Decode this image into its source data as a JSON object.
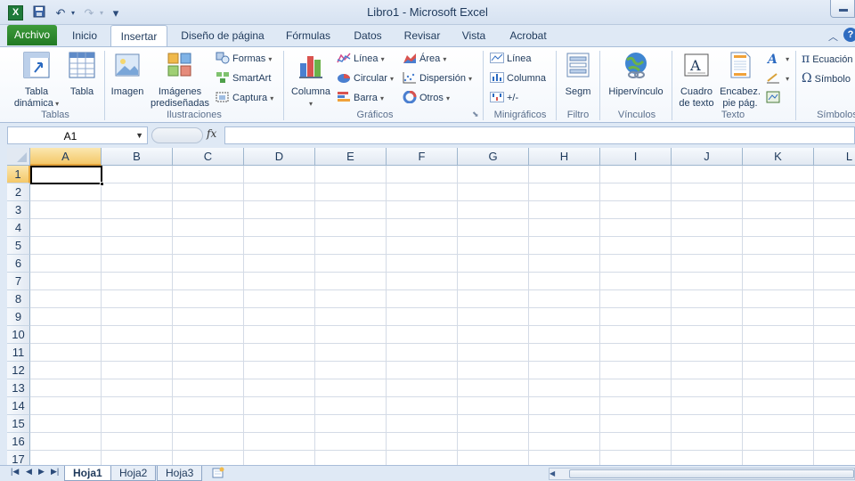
{
  "window": {
    "title": "Libro1  -  Microsoft Excel",
    "app_icon": "X"
  },
  "qat": {
    "save": "save-icon",
    "undo": "↶",
    "redo": "↷",
    "customize": "▾"
  },
  "tabs": {
    "file": "Archivo",
    "items": [
      "Inicio",
      "Insertar",
      "Diseño de página",
      "Fórmulas",
      "Datos",
      "Revisar",
      "Vista",
      "Acrobat"
    ],
    "active": "Insertar"
  },
  "ribbon": {
    "tablas": {
      "label": "Tablas",
      "pivot": "Tabla\ndinámica",
      "table": "Tabla"
    },
    "ilustraciones": {
      "label": "Ilustraciones",
      "image": "Imagen",
      "clipart": "Imágenes\nprediseñadas",
      "shapes": "Formas",
      "smartart": "SmartArt",
      "screenshot": "Captura"
    },
    "graficos": {
      "label": "Gráficos",
      "column": "Columna",
      "line": "Línea",
      "pie": "Circular",
      "bar": "Barra",
      "area": "Área",
      "scatter": "Dispersión",
      "other": "Otros"
    },
    "minigraficos": {
      "label": "Minigráficos",
      "line": "Línea",
      "column": "Columna",
      "winloss": "+/-"
    },
    "filtro": {
      "label": "Filtro",
      "slicer": "Segm"
    },
    "vinculos": {
      "label": "Vínculos",
      "hyperlink": "Hipervínculo"
    },
    "texto": {
      "label": "Texto",
      "textbox": "Cuadro\nde texto",
      "header": "Encabez.\npie pág."
    },
    "simbolos": {
      "label": "Símbolos",
      "equation": "Ecuación",
      "symbol": "Símbolo"
    }
  },
  "formula_bar": {
    "namebox": "A1",
    "fx": "fx",
    "value": ""
  },
  "grid": {
    "columns": [
      "A",
      "B",
      "C",
      "D",
      "E",
      "F",
      "G",
      "H",
      "I",
      "J",
      "K",
      "L"
    ],
    "rows": [
      "1",
      "2",
      "3",
      "4",
      "5",
      "6",
      "7",
      "8",
      "9",
      "10",
      "11",
      "12",
      "13",
      "14",
      "15",
      "16",
      "17"
    ],
    "active_cell": "A1"
  },
  "sheets": {
    "tabs": [
      "Hoja1",
      "Hoja2",
      "Hoja3"
    ],
    "active": "Hoja1"
  },
  "colors": {
    "accent": "#217a24",
    "selection": "#f4c869",
    "ribbon_bg": "#dfe9f5"
  }
}
